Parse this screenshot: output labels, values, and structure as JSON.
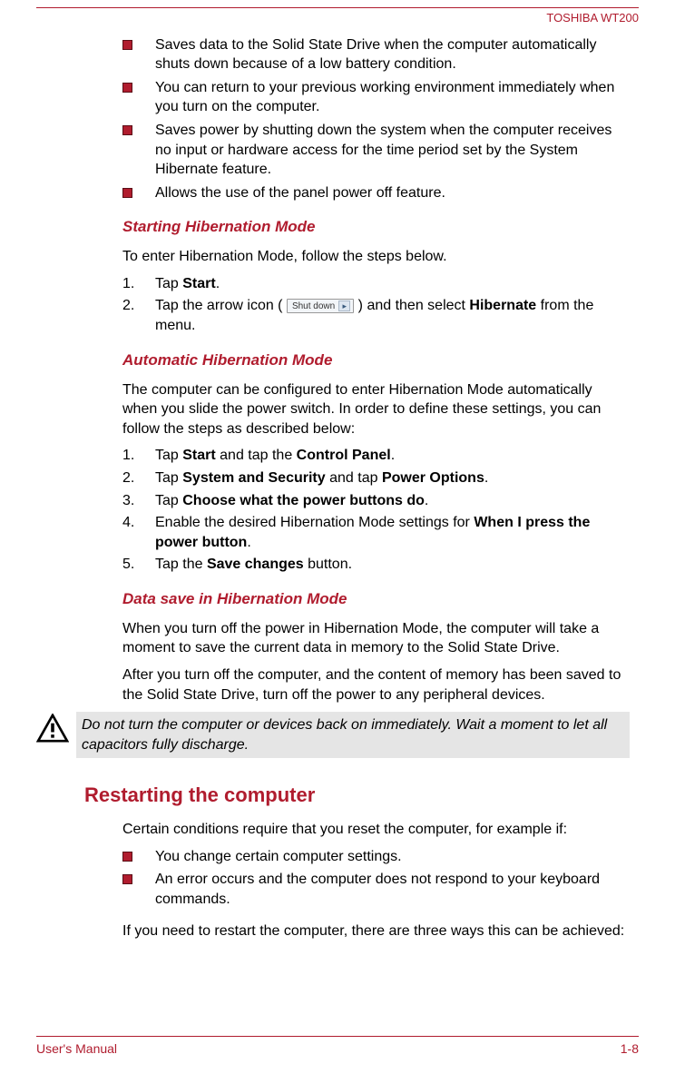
{
  "header": {
    "model": "TOSHIBA WT200"
  },
  "intro_bullets": [
    "Saves data to the Solid State Drive when the computer automatically shuts down because of a low battery condition.",
    "You can return to your previous working environment immediately when you turn on the computer.",
    "Saves power by shutting down the system when the computer receives no input or hardware access for the time period set by the System Hibernate feature.",
    "Allows the use of the panel power off feature."
  ],
  "sections": {
    "starting": {
      "title": "Starting Hibernation Mode",
      "intro": "To enter Hibernation Mode, follow the steps below.",
      "step1_a": "Tap ",
      "step1_b": "Start",
      "step1_c": ".",
      "step2_a": "Tap the arrow icon ( ",
      "shutdown_label": "Shut down",
      "step2_b": " ) and then select ",
      "step2_c": "Hibernate",
      "step2_d": " from the menu."
    },
    "automatic": {
      "title": "Automatic Hibernation Mode",
      "intro": "The computer can be configured to enter Hibernation Mode automatically when you slide the power switch. In order to define these settings, you can follow the steps as described below:",
      "s1a": "Tap ",
      "s1b": "Start",
      "s1c": " and tap the ",
      "s1d": "Control Panel",
      "s1e": ".",
      "s2a": "Tap ",
      "s2b": "System and Security",
      "s2c": " and tap ",
      "s2d": "Power Options",
      "s2e": ".",
      "s3a": "Tap ",
      "s3b": "Choose what the power buttons do",
      "s3c": ".",
      "s4a": "Enable the desired Hibernation Mode settings for ",
      "s4b": "When I press the power button",
      "s4c": ".",
      "s5a": "Tap the ",
      "s5b": "Save changes",
      "s5c": " button."
    },
    "datasave": {
      "title": "Data save in Hibernation Mode",
      "p1": "When you turn off the power in Hibernation Mode, the computer will take a moment to save the current data in memory to the Solid State Drive.",
      "p2": "After you turn off the computer, and the content of memory has been saved to the Solid State Drive, turn off the power to any peripheral devices.",
      "caution": "Do not turn the computer or devices back on immediately. Wait a moment to let all capacitors fully discharge."
    },
    "restart": {
      "title": "Restarting the computer",
      "intro": "Certain conditions require that you reset the computer, for example if:",
      "bullets": [
        "You change certain computer settings.",
        "An error occurs and the computer does not respond to your keyboard commands."
      ],
      "outro": "If you need to restart the computer, there are three ways this can be achieved:"
    }
  },
  "footer": {
    "left": "User's Manual",
    "right": "1-8"
  }
}
